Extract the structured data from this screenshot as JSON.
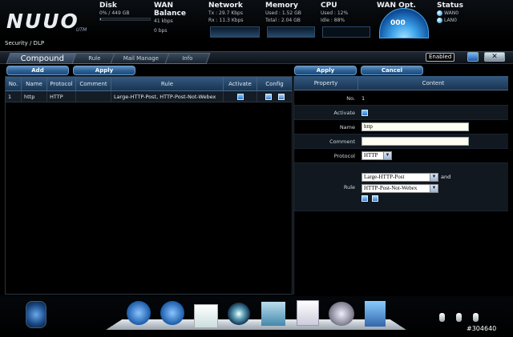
{
  "brand": {
    "logo": "NUUO",
    "sub": "UTM"
  },
  "stats": {
    "disk": {
      "title": "Disk",
      "value": "0% / 449 GB",
      "fill_pct": 2
    },
    "wan_balance": {
      "title": "WAN Balance",
      "line1": "41 kbps",
      "line2": "0 bps"
    },
    "network": {
      "title": "Network",
      "tx": "Tx : 29.7 Kbps",
      "rx": "Rx : 11.3 Kbps"
    },
    "memory": {
      "title": "Memory",
      "used": "Used : 1.52 GB",
      "total": "Total : 2.04 GB"
    },
    "cpu": {
      "title": "CPU",
      "used": "Used : 12%",
      "idle": "Idle : 88%"
    },
    "wan_opt": {
      "title": "WAN Opt.",
      "gauge": "000"
    },
    "status": {
      "title": "Status",
      "wan": "WAN0",
      "lan": "LAN0"
    }
  },
  "breadcrumb": "Security / DLP",
  "tabs": [
    "Compound",
    "Rule",
    "Mail Manage",
    "Info"
  ],
  "enabled_label": "Enabled",
  "left": {
    "add": "Add",
    "apply": "Apply",
    "columns": [
      "No.",
      "Name",
      "Protocol",
      "Comment",
      "Rule",
      "Activate",
      "Config"
    ],
    "rows": [
      {
        "no": "1",
        "name": "http",
        "protocol": "HTTP",
        "comment": "",
        "rule": "Large-HTTP-Post, HTTP-Post-Not-Webex",
        "activate": true
      }
    ]
  },
  "right": {
    "apply": "Apply",
    "cancel": "Cancel",
    "columns": [
      "Property",
      "Content"
    ],
    "no_label": "No.",
    "no_value": "1",
    "activate_label": "Activate",
    "name_label": "Name",
    "name_value": "http",
    "comment_label": "Comment",
    "comment_value": "",
    "protocol_label": "Protocol",
    "protocol_value": "HTTP",
    "rule_label": "Rule",
    "rule1": "Large-HTTP-Post",
    "rule_and": "and",
    "rule2": "HTTP-Post-Not-Webex"
  },
  "footer_id": "#304640"
}
